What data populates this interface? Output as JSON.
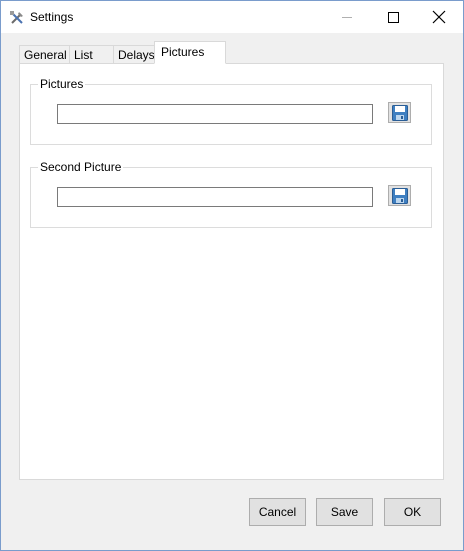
{
  "window": {
    "title": "Settings"
  },
  "tabs": [
    {
      "label": "General"
    },
    {
      "label": "List"
    },
    {
      "label": "Delays"
    },
    {
      "label": "Pictures"
    }
  ],
  "active_tab": "Pictures",
  "pictures_group": {
    "legend": "Pictures",
    "path_value": ""
  },
  "second_picture_group": {
    "legend": "Second Picture",
    "path_value": ""
  },
  "buttons": {
    "cancel": "Cancel",
    "save": "Save",
    "ok": "OK"
  },
  "icons": {
    "app": "tools-icon",
    "browse": "floppy-disk-icon"
  },
  "colors": {
    "window_border": "#7a9ccc",
    "button_face": "#e1e1e1",
    "floppy_blue": "#3e7fc1"
  }
}
